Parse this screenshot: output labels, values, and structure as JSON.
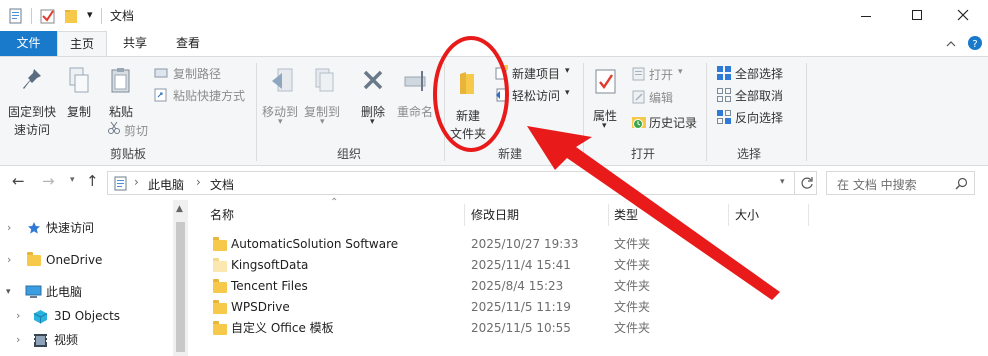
{
  "window": {
    "title": "文档",
    "qa_dropdown": "▾"
  },
  "menu_tabs": [
    "文件",
    "主页",
    "共享",
    "查看"
  ],
  "ribbon": {
    "clipboard": {
      "pin": "固定到快速访问",
      "pin_l1": "固定到快",
      "pin_l2": "速访问",
      "copy": "复制",
      "paste": "粘贴",
      "copy_path": "复制路径",
      "paste_shortcut": "粘贴快捷方式",
      "cut": "剪切",
      "group": "剪贴板"
    },
    "organize": {
      "move_to": "移动到",
      "copy_to": "复制到",
      "delete": "删除",
      "rename": "重命名",
      "group": "组织"
    },
    "new": {
      "new_folder_l1": "新建",
      "new_folder_l2": "文件夹",
      "new_item": "新建项目",
      "easy_access": "轻松访问",
      "group": "新建"
    },
    "open": {
      "properties": "属性",
      "open": "打开",
      "edit": "编辑",
      "history": "历史记录",
      "group": "打开"
    },
    "select": {
      "select_all": "全部选择",
      "select_none": "全部取消",
      "invert": "反向选择",
      "group": "选择"
    }
  },
  "address": {
    "crumbs": [
      "此电脑",
      "文档"
    ],
    "search_placeholder": "在 文档 中搜索"
  },
  "nav": [
    {
      "label": "快速访问",
      "icon": "star-icon"
    },
    {
      "label": "OneDrive",
      "icon": "folder-icon"
    },
    {
      "label": "此电脑",
      "icon": "computer-icon"
    },
    {
      "label": "3D Objects",
      "icon": "cube-icon"
    },
    {
      "label": "视频",
      "icon": "video-icon"
    }
  ],
  "columns": [
    "名称",
    "修改日期",
    "类型",
    "大小"
  ],
  "files": [
    {
      "name": "AutomaticSolution Software",
      "date": "2025/10/27 19:33",
      "type": "文件夹",
      "pale": false
    },
    {
      "name": "KingsoftData",
      "date": "2025/11/4 15:41",
      "type": "文件夹",
      "pale": true
    },
    {
      "name": "Tencent Files",
      "date": "2025/8/4 15:23",
      "type": "文件夹",
      "pale": false
    },
    {
      "name": "WPSDrive",
      "date": "2025/11/5 11:19",
      "type": "文件夹",
      "pale": false
    },
    {
      "name": "自定义 Office 模板",
      "date": "2025/11/5 10:55",
      "type": "文件夹",
      "pale": false
    }
  ],
  "colors": {
    "file_tab": "#1979ca",
    "annotation_red": "#e81a1a",
    "folder": "#f6c94b"
  }
}
